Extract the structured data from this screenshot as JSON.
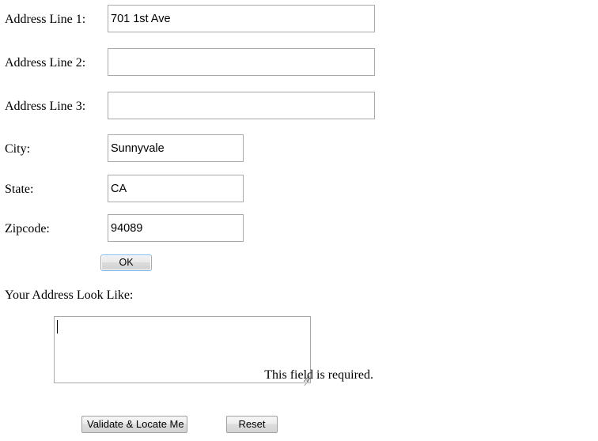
{
  "form": {
    "fields": [
      {
        "name": "address_line_1",
        "label": "Address Line 1:",
        "value": "701 1st Ave",
        "placeholder": "",
        "width": "wide"
      },
      {
        "name": "address_line_2",
        "label": "Address Line 2:",
        "value": "",
        "placeholder": "",
        "width": "wide"
      },
      {
        "name": "address_line_3",
        "label": "Address Line 3:",
        "value": "",
        "placeholder": "",
        "width": "wide"
      },
      {
        "name": "city",
        "label": "City:",
        "value": "Sunnyvale",
        "placeholder": "",
        "width": "narrow"
      },
      {
        "name": "state",
        "label": "State:",
        "value": "CA",
        "placeholder": "",
        "width": "narrow"
      },
      {
        "name": "zipcode",
        "label": "Zipcode:",
        "value": "94089",
        "placeholder": "",
        "width": "narrow"
      }
    ],
    "ok_button_label": "OK"
  },
  "result": {
    "title": "Your Address Look Like:",
    "textarea_value": "",
    "textarea_placeholder": "",
    "validation_message": "This field is required."
  },
  "actions": {
    "validate_label": "Validate & Locate Me",
    "reset_label": "Reset"
  },
  "colors": {
    "page_background": "#ffffff",
    "text": "#000000",
    "input_border": "#a9a9a9",
    "button_border": "#a0a0a0",
    "focus_border": "#7eb4ea",
    "button_face": "#dedede"
  }
}
